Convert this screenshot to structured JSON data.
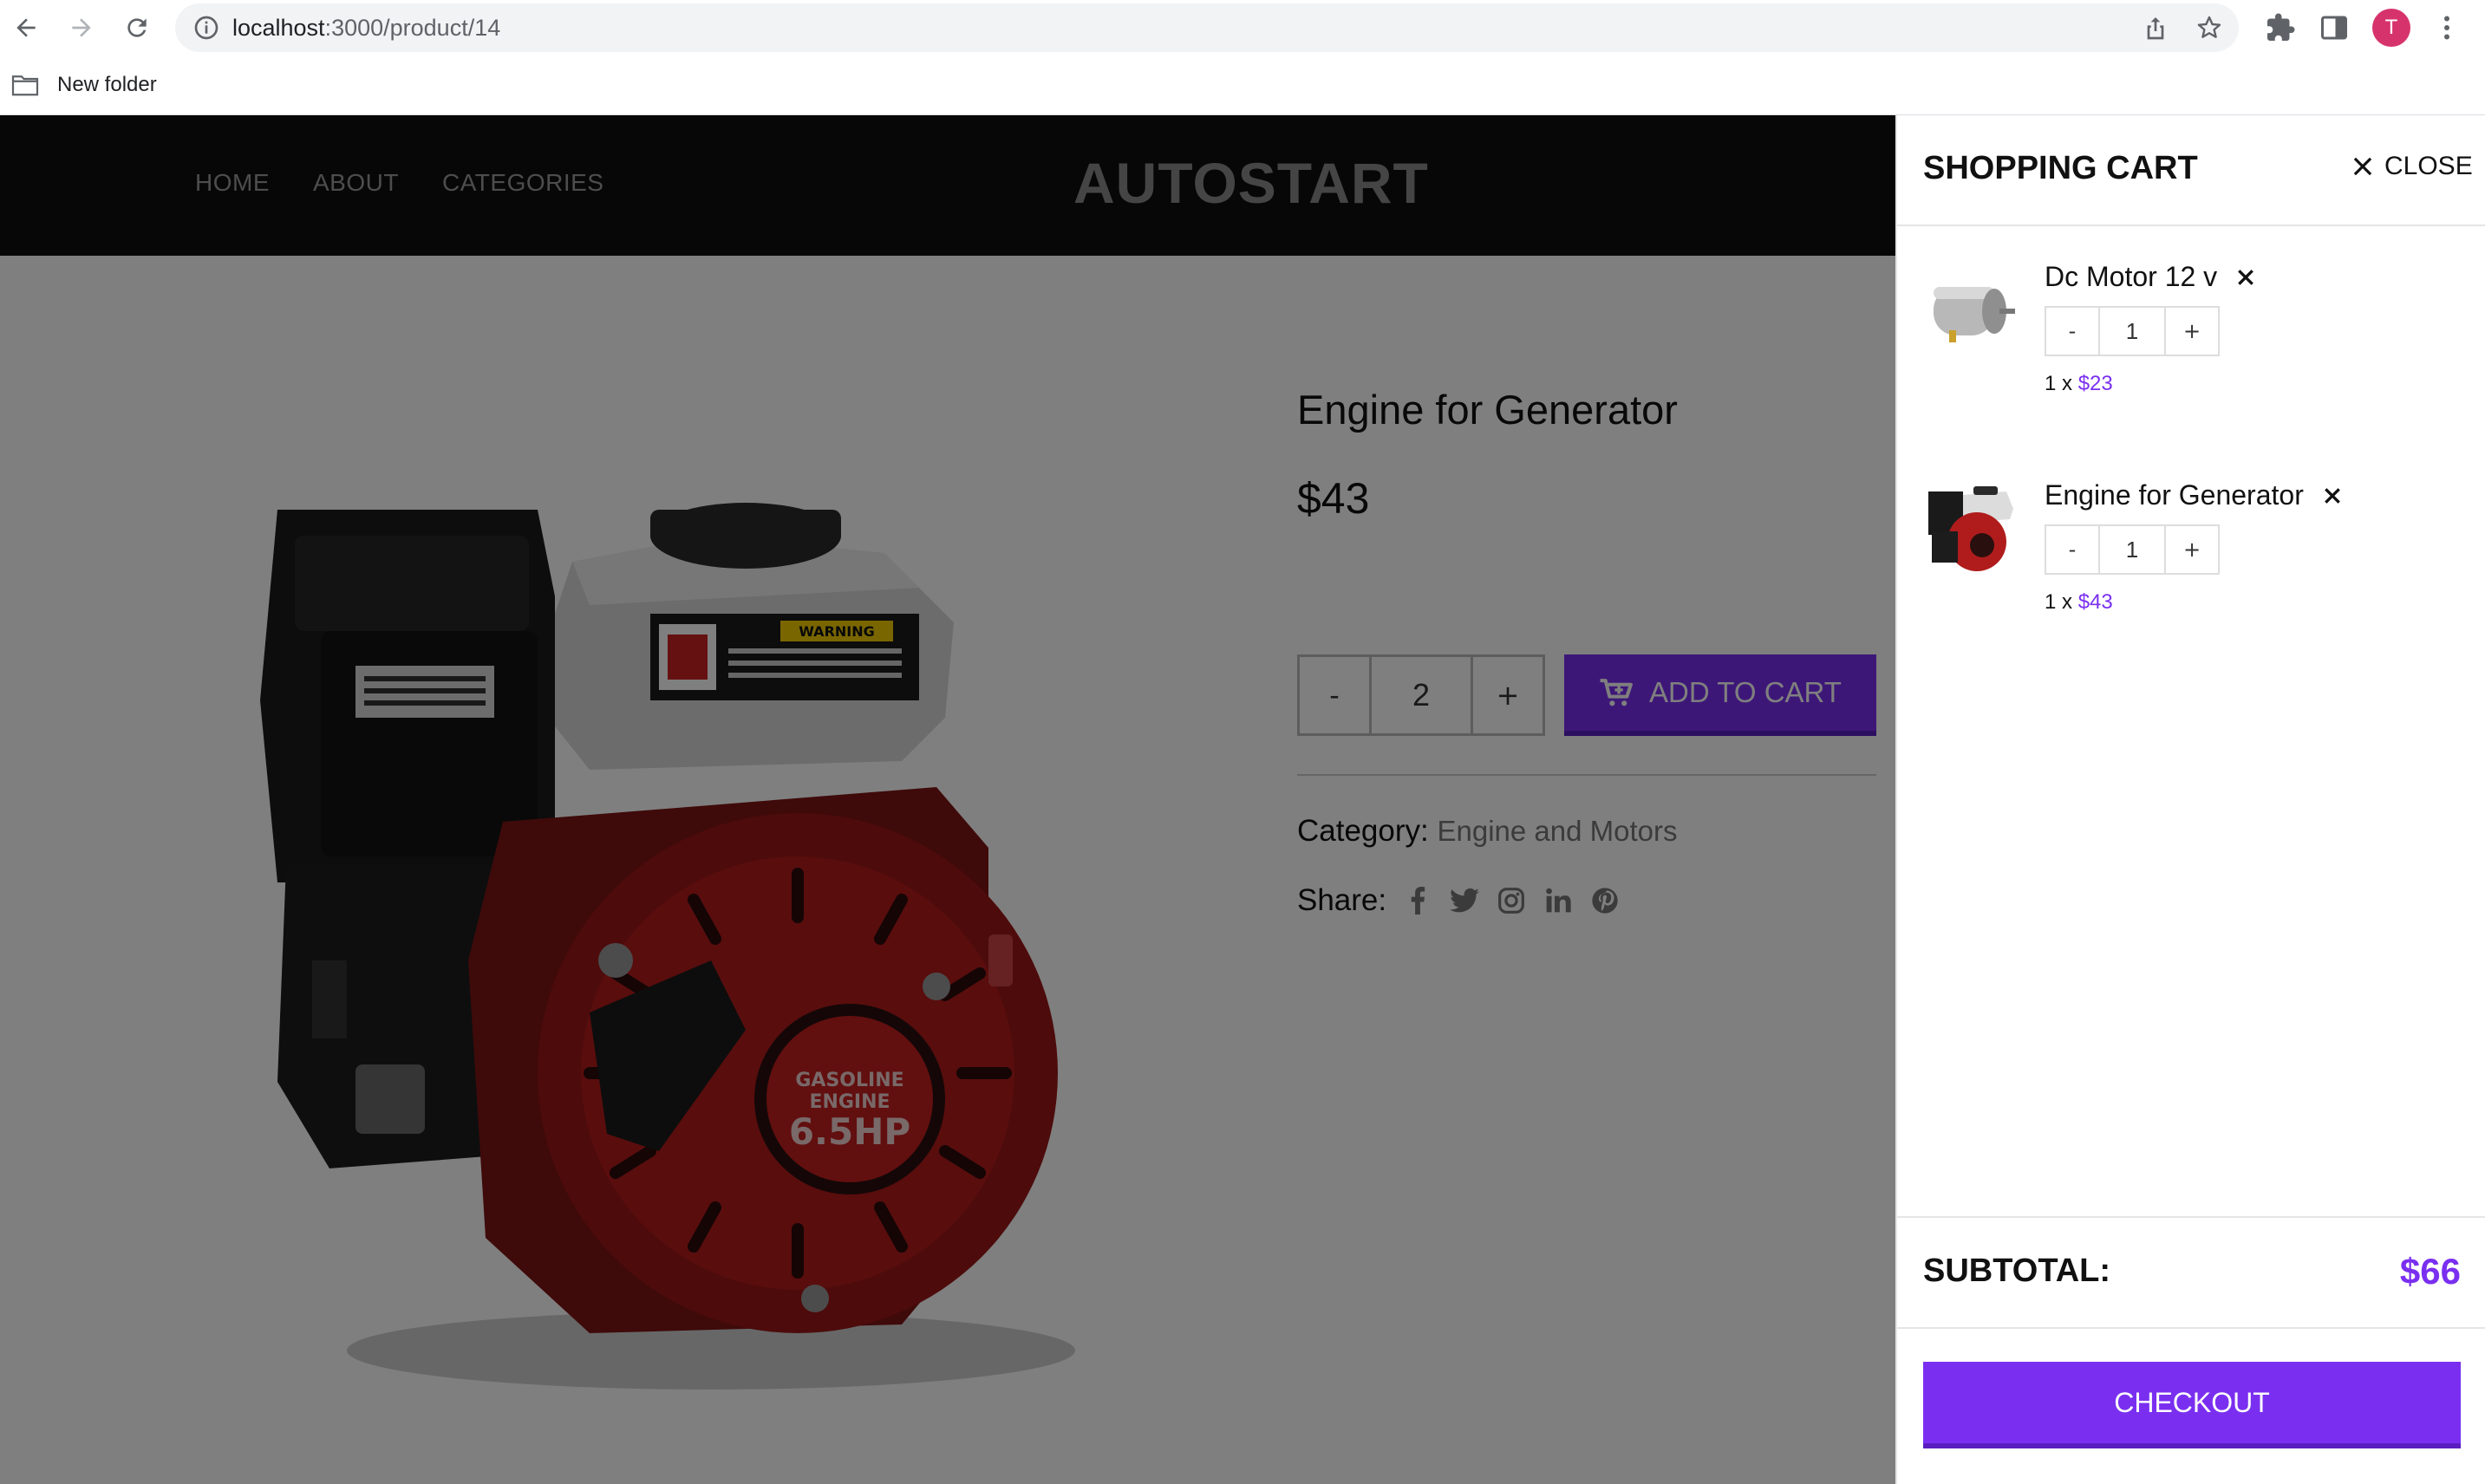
{
  "browser": {
    "url_host": "localhost",
    "url_path": ":3000/product/14",
    "bookmarks": [
      {
        "label": "New folder"
      }
    ],
    "profile_initial": "T"
  },
  "site": {
    "logo": "AUTOSTART",
    "nav": [
      {
        "label": "HOME"
      },
      {
        "label": "ABOUT"
      },
      {
        "label": "CATEGORIES"
      }
    ]
  },
  "product": {
    "title": "Engine for Generator",
    "price": "$43",
    "quantity": "2",
    "qty_minus": "-",
    "qty_plus": "+",
    "add_to_cart": "ADD TO CART",
    "category_label": "Category:",
    "category_value": "Engine and Motors",
    "share_label": "Share:",
    "share_icons": [
      "facebook-icon",
      "twitter-icon",
      "instagram-icon",
      "linkedin-icon",
      "pinterest-icon"
    ],
    "engine_label": "GASOLINE ENGINE 6.5HP",
    "warning_label": "WARNING"
  },
  "cart": {
    "title": "SHOPPING CART",
    "close_label": "CLOSE",
    "items": [
      {
        "name": "Dc Motor 12 v",
        "qty": "1",
        "line_qty": "1 x",
        "line_price": "$23",
        "minus": "-",
        "plus": "+"
      },
      {
        "name": "Engine for Generator",
        "qty": "1",
        "line_qty": "1 x",
        "line_price": "$43",
        "minus": "-",
        "plus": "+"
      }
    ],
    "subtotal_label": "SUBTOTAL:",
    "subtotal_value": "$66",
    "checkout_label": "CHECKOUT"
  },
  "colors": {
    "accent": "#7a2ff0",
    "header_bg": "#0f0f0f",
    "overlay": "rgba(0,0,0,0.5)",
    "avatar": "#d6336c"
  }
}
